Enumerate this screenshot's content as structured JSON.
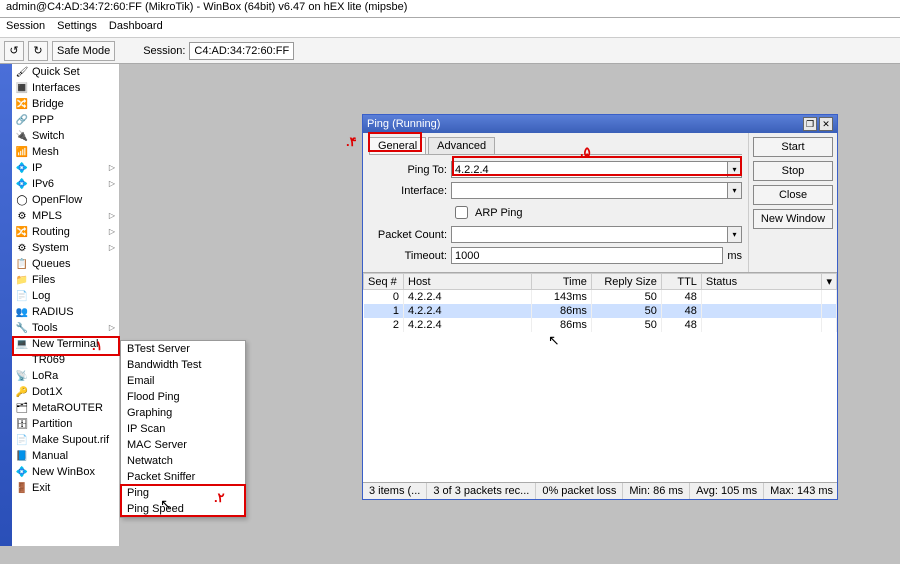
{
  "window": {
    "title": "admin@C4:AD:34:72:60:FF (MikroTik) - WinBox (64bit) v6.47 on hEX lite (mipsbe)"
  },
  "menubar": [
    "Session",
    "Settings",
    "Dashboard"
  ],
  "toolbar": {
    "safe_mode": "Safe Mode",
    "session_label": "Session:",
    "session_value": "C4:AD:34:72:60:FF"
  },
  "sidebar": [
    {
      "label": "Quick Set",
      "icon": "🖌",
      "arrow": false
    },
    {
      "label": "Interfaces",
      "icon": "🔳",
      "arrow": false
    },
    {
      "label": "Bridge",
      "icon": "🔀",
      "arrow": false
    },
    {
      "label": "PPP",
      "icon": "🔗",
      "arrow": false
    },
    {
      "label": "Switch",
      "icon": "🔌",
      "arrow": false
    },
    {
      "label": "Mesh",
      "icon": "📶",
      "arrow": false
    },
    {
      "label": "IP",
      "icon": "💠",
      "arrow": true
    },
    {
      "label": "IPv6",
      "icon": "💠",
      "arrow": true
    },
    {
      "label": "OpenFlow",
      "icon": "◯",
      "arrow": false
    },
    {
      "label": "MPLS",
      "icon": "⚙",
      "arrow": true
    },
    {
      "label": "Routing",
      "icon": "🔀",
      "arrow": true
    },
    {
      "label": "System",
      "icon": "⚙",
      "arrow": true
    },
    {
      "label": "Queues",
      "icon": "📋",
      "arrow": false
    },
    {
      "label": "Files",
      "icon": "📁",
      "arrow": false
    },
    {
      "label": "Log",
      "icon": "📄",
      "arrow": false
    },
    {
      "label": "RADIUS",
      "icon": "👥",
      "arrow": false
    },
    {
      "label": "Tools",
      "icon": "🔧",
      "arrow": true
    },
    {
      "label": "New Terminal",
      "icon": "💻",
      "arrow": false
    },
    {
      "label": "TR069",
      "icon": "",
      "arrow": false
    },
    {
      "label": "LoRa",
      "icon": "📡",
      "arrow": false
    },
    {
      "label": "Dot1X",
      "icon": "🔑",
      "arrow": false
    },
    {
      "label": "MetaROUTER",
      "icon": "🗂",
      "arrow": false
    },
    {
      "label": "Partition",
      "icon": "🗄",
      "arrow": false
    },
    {
      "label": "Make Supout.rif",
      "icon": "📄",
      "arrow": false
    },
    {
      "label": "Manual",
      "icon": "📘",
      "arrow": false
    },
    {
      "label": "New WinBox",
      "icon": "💠",
      "arrow": false
    },
    {
      "label": "Exit",
      "icon": "🚪",
      "arrow": false
    }
  ],
  "tools_menu": [
    "BTest Server",
    "Bandwidth Test",
    "Email",
    "Flood Ping",
    "Graphing",
    "IP Scan",
    "MAC Server",
    "Netwatch",
    "Packet Sniffer",
    "Ping",
    "Ping Speed"
  ],
  "ping": {
    "title": "Ping (Running)",
    "tabs": {
      "general": "General",
      "advanced": "Advanced"
    },
    "labels": {
      "ping_to": "Ping To:",
      "interface": "Interface:",
      "arp_ping": "ARP Ping",
      "packet_count": "Packet Count:",
      "timeout": "Timeout:",
      "ms": "ms"
    },
    "values": {
      "ping_to": "4.2.2.4",
      "interface": "",
      "packet_count": "",
      "timeout": "1000"
    },
    "buttons": {
      "start": "Start",
      "stop": "Stop",
      "close": "Close",
      "new_window": "New Window"
    },
    "columns": [
      "Seq #",
      "Host",
      "Time",
      "Reply Size",
      "TTL",
      "Status"
    ],
    "rows": [
      {
        "seq": "0",
        "host": "4.2.2.4",
        "time": "143ms",
        "size": "50",
        "ttl": "48",
        "status": ""
      },
      {
        "seq": "1",
        "host": "4.2.2.4",
        "time": "86ms",
        "size": "50",
        "ttl": "48",
        "status": ""
      },
      {
        "seq": "2",
        "host": "4.2.2.4",
        "time": "86ms",
        "size": "50",
        "ttl": "48",
        "status": ""
      }
    ],
    "status": {
      "items": "3 items (...",
      "received": "3 of 3 packets rec...",
      "loss": "0% packet loss",
      "min": "Min: 86 ms",
      "avg": "Avg: 105 ms",
      "max": "Max: 143 ms"
    }
  },
  "annotations": {
    "a1": ".۱",
    "a2": ".۲",
    "a4": ".۴",
    "a5": ".۵"
  }
}
